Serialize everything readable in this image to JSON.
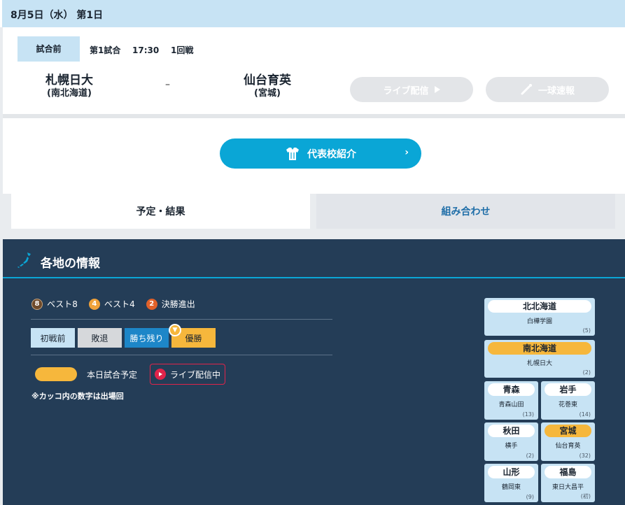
{
  "header": {
    "date": "8月5日（水） 第1日"
  },
  "match": {
    "status": "試合前",
    "info": "第1試合    17:30    1回戦",
    "home": {
      "name": "札幌日大",
      "region": "(南北海道)"
    },
    "away": {
      "name": "仙台育英",
      "region": "(宮城)"
    },
    "separator": "–",
    "live_button": "ライブ配信",
    "pitch_button": "一球速報"
  },
  "representative_button": "代表校紹介",
  "tabs": {
    "schedule": "予定・結果",
    "bracket": "組み合わせ"
  },
  "regional": {
    "title": "各地の情報",
    "legend": {
      "best8_num": "8",
      "best8": "ベスト8",
      "best4_num": "4",
      "best4": "ベスト4",
      "final_num": "2",
      "final": "決勝進出"
    },
    "status": {
      "pre": "初戦前",
      "lost": "敗退",
      "alive": "勝ち残り",
      "champion": "優勝"
    },
    "today_label": "本日試合予定",
    "live_label": "ライブ配信中",
    "note": "※カッコ内の数字は出場回"
  },
  "prefectures": [
    {
      "name": "北北海道",
      "school": "白樺学園",
      "count": "(5)",
      "today": false
    },
    {
      "name": "南北海道",
      "school": "札幌日大",
      "count": "(2)",
      "today": true
    },
    {
      "name": "青森",
      "school": "青森山田",
      "count": "(13)",
      "today": false
    },
    {
      "name": "岩手",
      "school": "花巻東",
      "count": "(14)",
      "today": false
    },
    {
      "name": "秋田",
      "school": "横手",
      "count": "(2)",
      "today": false
    },
    {
      "name": "宮城",
      "school": "仙台育英",
      "count": "(32)",
      "today": true
    },
    {
      "name": "山形",
      "school": "鶴岡東",
      "count": "(9)",
      "today": false
    },
    {
      "name": "福島",
      "school": "東日大昌平",
      "count": "(初)",
      "today": false
    }
  ],
  "colors": {
    "header_blue": "#c7e3f4",
    "accent_cyan": "#0aa6d6",
    "navy": "#243d57",
    "today_yellow": "#f6b73c",
    "live_red": "#e0244a"
  }
}
